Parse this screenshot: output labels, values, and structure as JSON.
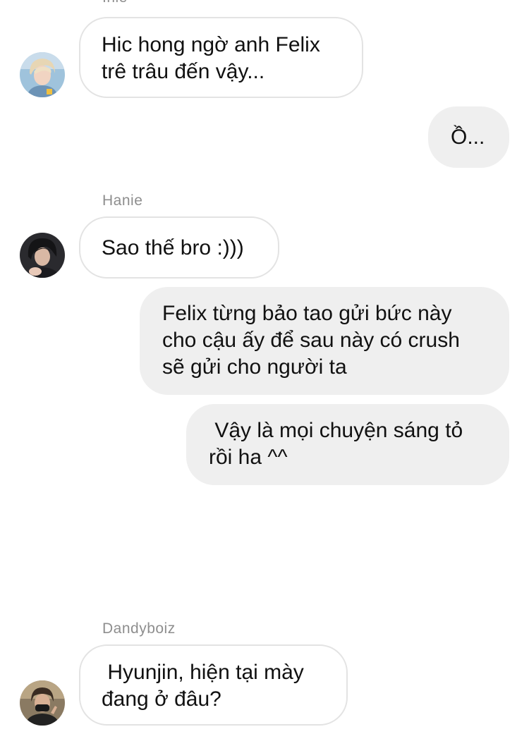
{
  "messages": [
    {
      "sender": "Inie",
      "text": "Hic hong ngờ anh Felix\ntrê trâu đến vậy...",
      "avatar": "avatar-blond-boy"
    },
    {
      "text": "Ồ..."
    },
    {
      "sender": "Hanie",
      "text": "Sao thế bro :)))",
      "avatar": "avatar-dark-hair-boy"
    },
    {
      "text": "Felix từng bảo tao gửi bức này\ncho cậu ấy để sau này có crush\nsẽ gửi cho người ta"
    },
    {
      "text": " Vậy là mọi chuyện sáng tỏ\nrồi ha ^^"
    },
    {
      "sender": "Dandyboiz",
      "text": " Hyunjin, hiện tại mày\nđang ở đâu?",
      "avatar": "avatar-masked-boy"
    }
  ],
  "colors": {
    "incoming_bubble": "#ffffff",
    "incoming_border": "#e3e3e3",
    "outgoing_bubble": "#efefef",
    "sender_name": "#8e8e8e",
    "text": "#111111"
  }
}
